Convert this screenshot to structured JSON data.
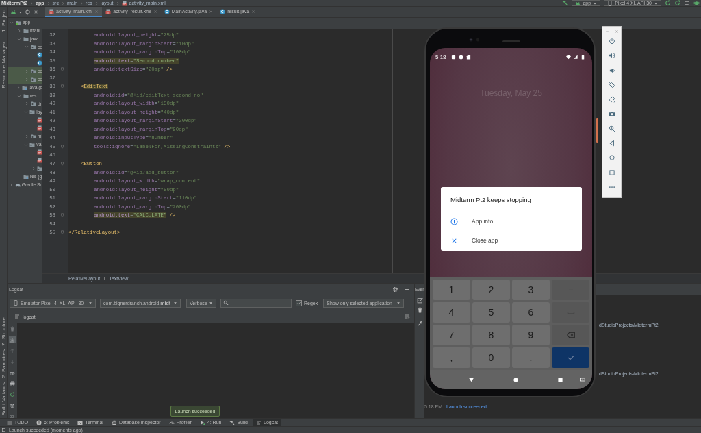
{
  "breadcrumbs": [
    {
      "label": "MidtermPt2",
      "kind": "project"
    },
    {
      "label": "app",
      "kind": "module"
    },
    {
      "label": "src",
      "kind": "folder"
    },
    {
      "label": "main",
      "kind": "folder"
    },
    {
      "label": "res",
      "kind": "folder"
    },
    {
      "label": "layout",
      "kind": "folder"
    },
    {
      "label": "activity_main.xml",
      "kind": "xml"
    }
  ],
  "run_config": {
    "label": "app"
  },
  "device": {
    "label": "Pixel 4 XL API 30"
  },
  "side_stripe": [
    {
      "label": "1: Project",
      "kind": "top"
    },
    {
      "label": "Resource Manager",
      "kind": "top"
    },
    {
      "label": "Z: Structure",
      "kind": "bottom"
    },
    {
      "label": "2: Favorites",
      "kind": "bottom"
    },
    {
      "label": "Build Variants",
      "kind": "bottom"
    }
  ],
  "tabs": [
    {
      "label": "activity_main.xml",
      "kind": "xml",
      "selected": true
    },
    {
      "label": "activity_result.xml",
      "kind": "xml",
      "selected": false
    },
    {
      "label": "MainActivity.java",
      "kind": "class",
      "selected": false
    },
    {
      "label": "result.java",
      "kind": "class",
      "selected": false
    }
  ],
  "project_tree": [
    {
      "label": "app",
      "kind": "module",
      "expanded": true,
      "selected": false,
      "children": [
        {
          "label": "mani",
          "kind": "folder",
          "expanded": false,
          "selected": false
        },
        {
          "label": "java",
          "kind": "folder",
          "expanded": true,
          "selected": false,
          "children": [
            {
              "label": "co",
              "kind": "package",
              "expanded": true,
              "selected": false,
              "children": [
                {
                  "kind": "class",
                  "selected": false
                },
                {
                  "kind": "class",
                  "selected": false
                }
              ]
            },
            {
              "label": "co",
              "kind": "package",
              "expanded": false,
              "selected": true
            },
            {
              "label": "co",
              "kind": "package",
              "expanded": false,
              "selected": true
            }
          ]
        },
        {
          "label": "java (g",
          "kind": "generated",
          "expanded": false,
          "selected": false
        },
        {
          "label": "res",
          "kind": "folder",
          "expanded": true,
          "selected": false,
          "children": [
            {
              "label": "dr",
              "kind": "package",
              "expanded": false,
              "selected": false
            },
            {
              "label": "lay",
              "kind": "package",
              "expanded": true,
              "selected": false,
              "children": [
                {
                  "kind": "xml",
                  "selected": false
                },
                {
                  "kind": "xml",
                  "selected": false
                }
              ]
            },
            {
              "label": "mi",
              "kind": "package",
              "expanded": false,
              "selected": false
            },
            {
              "label": "val",
              "kind": "package",
              "expanded": true,
              "selected": false,
              "children": [
                {
                  "kind": "xml",
                  "selected": false
                },
                {
                  "kind": "xml",
                  "selected": false
                },
                {
                  "kind": "package",
                  "expanded": false,
                  "selected": false
                }
              ]
            }
          ]
        },
        {
          "label": "res (g",
          "kind": "generated",
          "selected": false
        }
      ]
    },
    {
      "label": "Gradle Sc",
      "kind": "gradle",
      "expanded": false,
      "selected": false
    }
  ],
  "editor": {
    "lines": [
      {
        "number": "32",
        "kind": "attr",
        "fold": false,
        "highlighted": false,
        "tokens": [
          {
            "kind": "attr",
            "text": "android:layout_height"
          },
          {
            "kind": "op",
            "text": "="
          },
          {
            "kind": "str",
            "text": "\"25dp\""
          }
        ]
      },
      {
        "number": "33",
        "kind": "attr",
        "fold": false,
        "highlighted": false,
        "tokens": [
          {
            "kind": "attr",
            "text": "android:layout_marginStart"
          },
          {
            "kind": "op",
            "text": "="
          },
          {
            "kind": "str",
            "text": "\"10dp\""
          }
        ]
      },
      {
        "number": "34",
        "kind": "attr",
        "fold": false,
        "highlighted": false,
        "tokens": [
          {
            "kind": "attr",
            "text": "android:layout_marginTop"
          },
          {
            "kind": "op",
            "text": "="
          },
          {
            "kind": "str",
            "text": "\"100dp\""
          }
        ]
      },
      {
        "number": "35",
        "kind": "attr",
        "fold": false,
        "highlighted": true,
        "tokens": [
          {
            "kind": "attr",
            "text": "android:text"
          },
          {
            "kind": "op",
            "text": "="
          },
          {
            "kind": "str",
            "text": "\"Second number\""
          }
        ]
      },
      {
        "number": "36",
        "kind": "attr",
        "fold": true,
        "highlighted": false,
        "tokens": [
          {
            "kind": "attr",
            "text": "android:textSize"
          },
          {
            "kind": "op",
            "text": "="
          },
          {
            "kind": "str",
            "text": "\"20sp\""
          },
          {
            "kind": "end",
            "text": "/>"
          }
        ]
      },
      {
        "number": "37",
        "fold": false
      },
      {
        "number": "38",
        "kind": "open",
        "fold": true,
        "highlighted": true,
        "tokens": [
          {
            "kind": "bracket",
            "text": "<"
          },
          {
            "kind": "tag",
            "text": "EditText"
          }
        ]
      },
      {
        "number": "39",
        "kind": "attr",
        "fold": false,
        "highlighted": false,
        "tokens": [
          {
            "kind": "attr",
            "text": "android:id"
          },
          {
            "kind": "op",
            "text": "="
          },
          {
            "kind": "str",
            "text": "\"@+id/editText_second_no\""
          }
        ]
      },
      {
        "number": "40",
        "kind": "attr",
        "fold": false,
        "highlighted": false,
        "tokens": [
          {
            "kind": "attr",
            "text": "android:layout_width"
          },
          {
            "kind": "op",
            "text": "="
          },
          {
            "kind": "str",
            "text": "\"150dp\""
          }
        ]
      },
      {
        "number": "41",
        "kind": "attr",
        "fold": false,
        "highlighted": false,
        "tokens": [
          {
            "kind": "attr",
            "text": "android:layout_height"
          },
          {
            "kind": "op",
            "text": "="
          },
          {
            "kind": "str",
            "text": "\"40dp\""
          }
        ]
      },
      {
        "number": "42",
        "kind": "attr",
        "fold": false,
        "highlighted": false,
        "tokens": [
          {
            "kind": "attr",
            "text": "android:layout_marginStart"
          },
          {
            "kind": "op",
            "text": "="
          },
          {
            "kind": "str",
            "text": "\"200dp\""
          }
        ]
      },
      {
        "number": "43",
        "kind": "attr",
        "fold": false,
        "highlighted": false,
        "tokens": [
          {
            "kind": "attr",
            "text": "android:layout_marginTop"
          },
          {
            "kind": "op",
            "text": "="
          },
          {
            "kind": "str",
            "text": "\"90dp\""
          }
        ]
      },
      {
        "number": "44",
        "kind": "attr",
        "fold": false,
        "highlighted": false,
        "tokens": [
          {
            "kind": "attr",
            "text": "android:inputType"
          },
          {
            "kind": "op",
            "text": "="
          },
          {
            "kind": "str",
            "text": "\"number\""
          }
        ]
      },
      {
        "number": "45",
        "kind": "attr",
        "fold": true,
        "highlighted": false,
        "tokens": [
          {
            "kind": "attr",
            "text": "tools:ignore"
          },
          {
            "kind": "op",
            "text": "="
          },
          {
            "kind": "str",
            "text": "\"LabelFor,MissingConstraints\""
          },
          {
            "kind": "end",
            "text": "/>"
          }
        ]
      },
      {
        "number": "46",
        "fold": false
      },
      {
        "number": "47",
        "kind": "open",
        "fold": true,
        "highlighted": false,
        "tokens": [
          {
            "kind": "bracket",
            "text": "<"
          },
          {
            "kind": "tag",
            "text": "Button"
          }
        ]
      },
      {
        "number": "48",
        "kind": "attr",
        "fold": false,
        "highlighted": false,
        "tokens": [
          {
            "kind": "attr",
            "text": "android:id"
          },
          {
            "kind": "op",
            "text": "="
          },
          {
            "kind": "str",
            "text": "\"@+id/add_button\""
          }
        ]
      },
      {
        "number": "49",
        "kind": "attr",
        "fold": false,
        "highlighted": false,
        "tokens": [
          {
            "kind": "attr",
            "text": "android:layout_width"
          },
          {
            "kind": "op",
            "text": "="
          },
          {
            "kind": "str",
            "text": "\"wrap_content\""
          }
        ]
      },
      {
        "number": "50",
        "kind": "attr",
        "fold": false,
        "highlighted": false,
        "tokens": [
          {
            "kind": "attr",
            "text": "android:layout_height"
          },
          {
            "kind": "op",
            "text": "="
          },
          {
            "kind": "str",
            "text": "\"50dp\""
          }
        ]
      },
      {
        "number": "51",
        "kind": "attr",
        "fold": false,
        "highlighted": false,
        "tokens": [
          {
            "kind": "attr",
            "text": "android:layout_marginStart"
          },
          {
            "kind": "op",
            "text": "="
          },
          {
            "kind": "str",
            "text": "\"110dp\""
          }
        ]
      },
      {
        "number": "52",
        "kind": "attr",
        "fold": false,
        "highlighted": false,
        "tokens": [
          {
            "kind": "attr",
            "text": "android:layout_marginTop"
          },
          {
            "kind": "op",
            "text": "="
          },
          {
            "kind": "str",
            "text": "\"200dp\""
          }
        ]
      },
      {
        "number": "53",
        "kind": "attr",
        "fold": true,
        "highlighted": true,
        "tokens": [
          {
            "kind": "attr",
            "text": "android:text"
          },
          {
            "kind": "op",
            "text": "="
          },
          {
            "kind": "str",
            "text": "\"CALCULATE\""
          },
          {
            "kind": "end",
            "text": "/>"
          }
        ]
      },
      {
        "number": "54",
        "fold": false
      },
      {
        "number": "55",
        "kind": "close",
        "fold": true,
        "highlighted": false,
        "tokens": [
          {
            "kind": "tag",
            "text": "</RelativeLayout>"
          }
        ]
      }
    ],
    "breadcrumbs": [
      "RelativeLayout",
      "TextView"
    ]
  },
  "logcat": {
    "title": "Logcat",
    "device": "Emulator Pixel_4_XL_API_30",
    "package": "com.bignerdranch.android.**midt**",
    "level": "Verbose",
    "regex": {
      "label": "Regex",
      "checked": true
    },
    "filter": "Show only selected application",
    "subtitle": "logcat",
    "tools": [
      {
        "kind": "clear",
        "on": false,
        "disabled": true
      },
      {
        "kind": "scroll",
        "on": true,
        "disabled": false
      },
      {
        "kind": "up",
        "on": false,
        "disabled": true
      },
      {
        "kind": "down",
        "on": false,
        "disabled": true
      },
      {
        "kind": "wrap",
        "on": false,
        "disabled": false
      },
      {
        "kind": "print",
        "on": false,
        "disabled": false
      },
      {
        "kind": "restart",
        "on": false,
        "disabled": false
      },
      {
        "kind": "settings",
        "on": false,
        "disabled": false
      },
      {
        "kind": "more",
        "on": false,
        "disabled": false
      }
    ]
  },
  "event_log": {
    "title": "Even",
    "entries": [
      {
        "kind": "path",
        "text": "dStudioProjects\\MidtermPt2"
      },
      {
        "kind": "path",
        "text": "dStudioProjects\\MidtermPt2"
      },
      {
        "kind": "message",
        "time": "5:18 PM",
        "text": "Launch succeeded"
      }
    ]
  },
  "phone": {
    "time": "5:18",
    "date": "Tuesday, May 25",
    "dialog": {
      "title": "Midterm Pt2 keeps stopping",
      "actions": [
        {
          "kind": "info",
          "label": "App info"
        },
        {
          "kind": "close",
          "label": "Close app"
        }
      ]
    },
    "keys": [
      {
        "kind": "digit",
        "label": "1"
      },
      {
        "kind": "digit",
        "label": "2"
      },
      {
        "kind": "digit",
        "label": "3"
      },
      {
        "kind": "symbol",
        "label": "−"
      },
      {
        "kind": "digit",
        "label": "4"
      },
      {
        "kind": "digit",
        "label": "5"
      },
      {
        "kind": "digit",
        "label": "6"
      },
      {
        "kind": "space"
      },
      {
        "kind": "digit",
        "label": "7"
      },
      {
        "kind": "digit",
        "label": "8"
      },
      {
        "kind": "digit",
        "label": "9"
      },
      {
        "kind": "backspace"
      },
      {
        "kind": "digit",
        "label": ","
      },
      {
        "kind": "digit",
        "label": "0"
      },
      {
        "kind": "digit",
        "label": "."
      },
      {
        "kind": "done"
      }
    ]
  },
  "tooltip": "Launch succeeded",
  "tool_windows": [
    {
      "label": "TODO",
      "kind": "todo",
      "selected": false
    },
    {
      "label": "6: Problems",
      "kind": "problems",
      "selected": false
    },
    {
      "label": "Terminal",
      "kind": "terminal",
      "selected": false
    },
    {
      "label": "Database Inspector",
      "kind": "database",
      "selected": false
    },
    {
      "label": "Profiler",
      "kind": "profiler",
      "selected": false
    },
    {
      "label": "4: Run",
      "kind": "run",
      "selected": false
    },
    {
      "label": "Build",
      "kind": "build",
      "selected": false
    },
    {
      "label": "Logcat",
      "kind": "logcat",
      "selected": true
    }
  ],
  "status_bar": "Launch succeeded (moments ago)"
}
